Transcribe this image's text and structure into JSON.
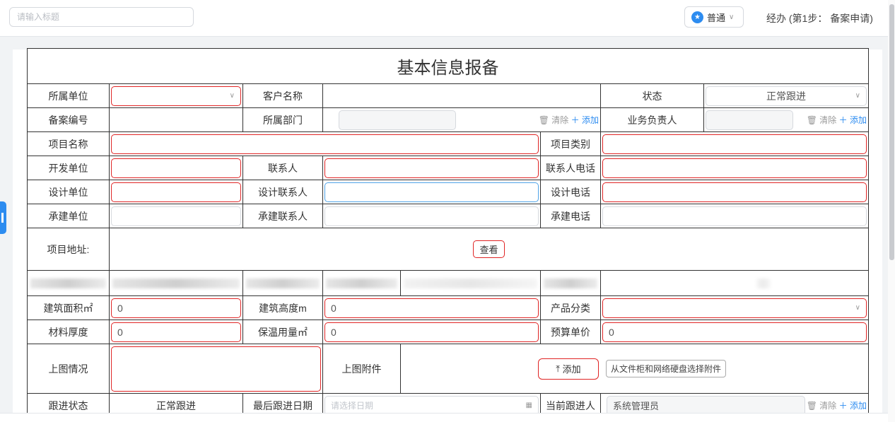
{
  "topbar": {
    "title_placeholder": "请输入标题",
    "level_label": "普通",
    "step_text": "经办 (第1步：  备案申请)"
  },
  "form": {
    "title": "基本信息报备",
    "labels": {
      "unit": "所属单位",
      "customer": "客户名称",
      "status": "状态",
      "record_no": "备案编号",
      "dept": "所属部门",
      "owner": "业务负责人",
      "project_name": "项目名称",
      "project_type": "项目类别",
      "developer": "开发单位",
      "contact": "联系人",
      "contact_phone": "联系人电话",
      "design_unit": "设计单位",
      "design_contact": "设计联系人",
      "design_phone": "设计电话",
      "contractor": "承建单位",
      "contractor_contact": "承建联系人",
      "contractor_phone": "承建电话",
      "address": "项目地址:",
      "area": "建筑面积㎡",
      "height": "建筑高度m",
      "product_cat": "产品分类",
      "thickness": "材料厚度",
      "insulation": "保温用量㎡",
      "budget_price": "预算单价",
      "drawing": "上图情况",
      "drawing_attach": "上图附件",
      "follow_status": "跟进状态",
      "last_follow_date": "最后跟进日期",
      "current_follower": "当前跟进人"
    },
    "values": {
      "status": "正常跟进",
      "area": "0",
      "height": "0",
      "thickness": "0",
      "insulation": "0",
      "budget_price": "0",
      "follow_status": "正常跟进",
      "date_placeholder": "请选择日期",
      "current_follower": "系统管理员"
    },
    "actions": {
      "clear": "清除",
      "add": "添加",
      "view": "查看",
      "upload_add": "添加",
      "choose_cabinet": "从文件柜和网络硬盘选择附件"
    }
  },
  "colors": {
    "accent": "#2d8cf0",
    "required_border": "#e02424"
  }
}
